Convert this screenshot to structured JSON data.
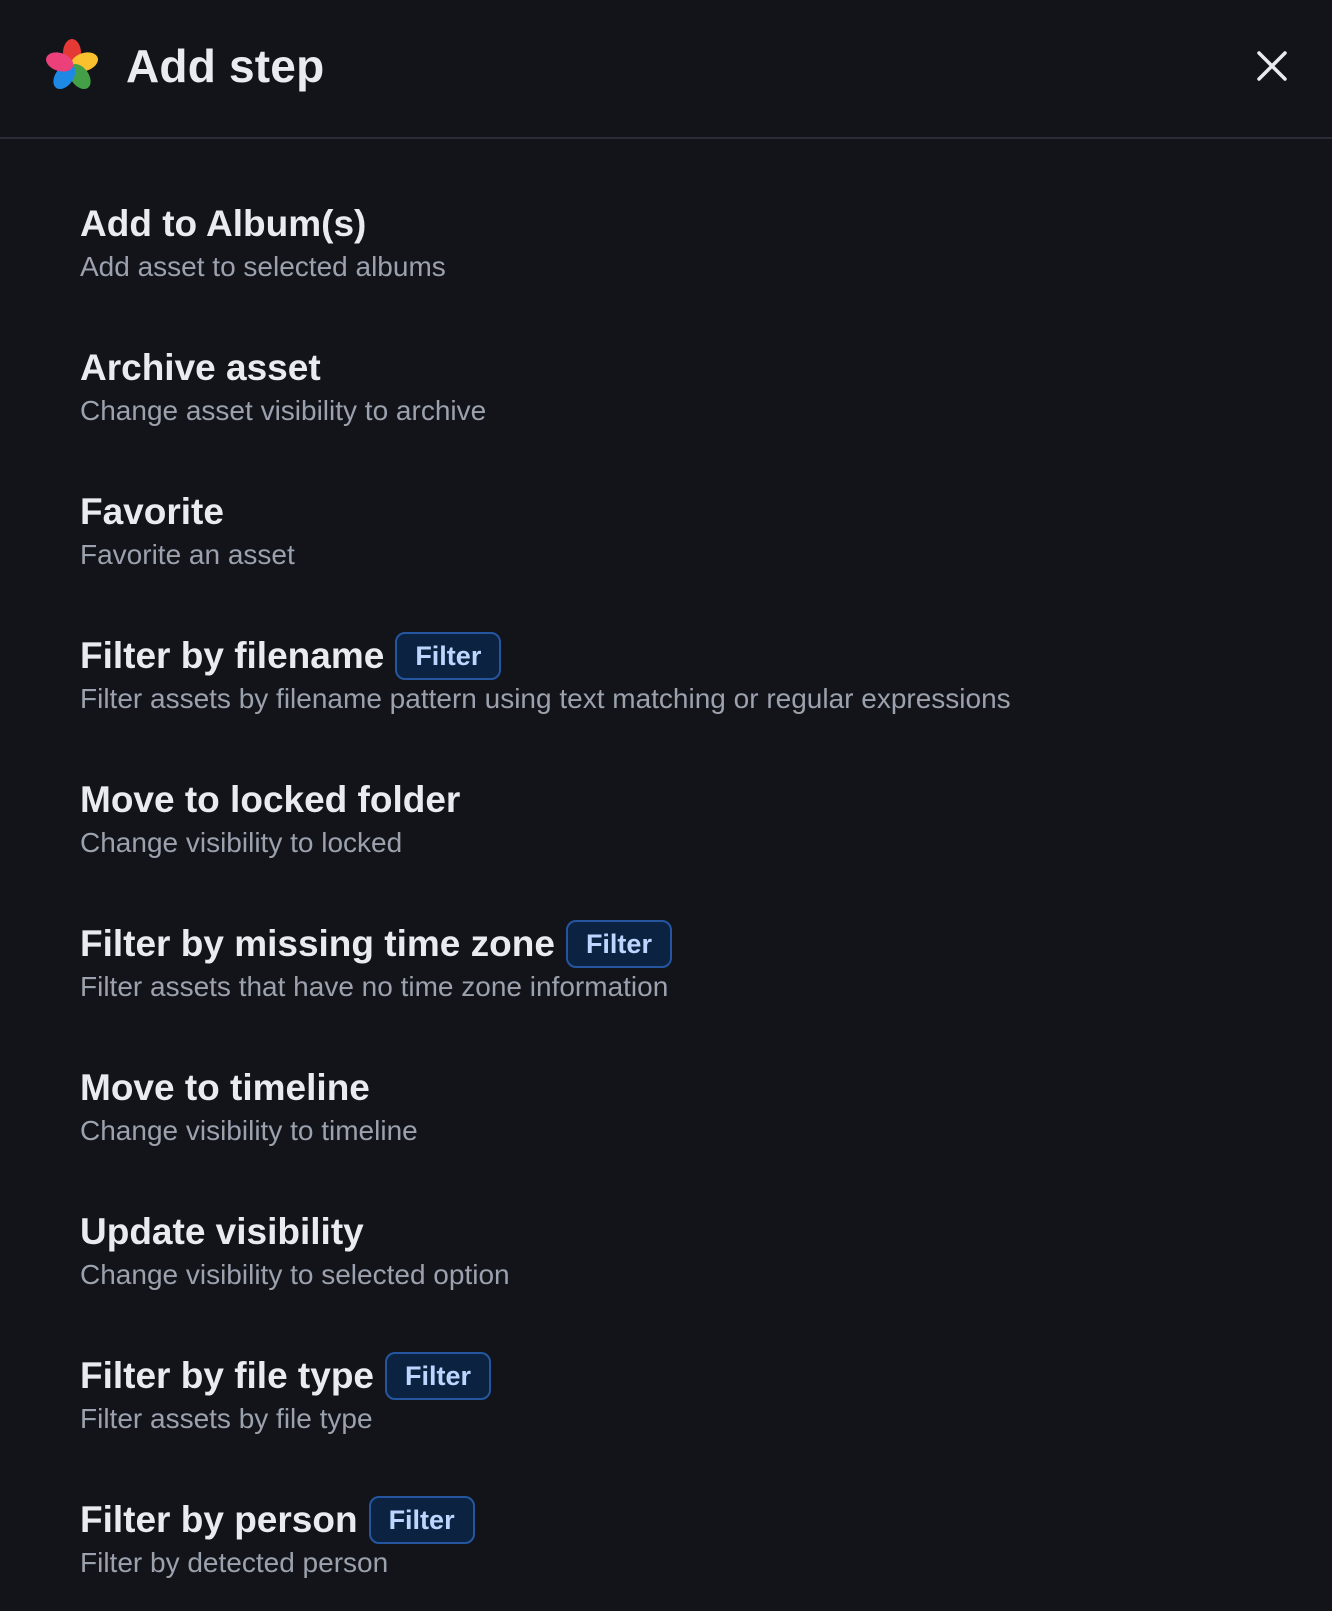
{
  "dialog": {
    "title": "Add step",
    "logo_icon": "app-pinwheel-logo",
    "close_icon": "close-icon"
  },
  "steps": [
    {
      "title": "Add to Album(s)",
      "description": "Add asset to selected albums",
      "badge": ""
    },
    {
      "title": "Archive asset",
      "description": "Change asset visibility to archive",
      "badge": ""
    },
    {
      "title": "Favorite",
      "description": "Favorite an asset",
      "badge": ""
    },
    {
      "title": "Filter by filename",
      "description": "Filter assets by filename pattern using text matching or regular expressions",
      "badge": "Filter"
    },
    {
      "title": "Move to locked folder",
      "description": "Change visibility to locked",
      "badge": ""
    },
    {
      "title": "Filter by missing time zone",
      "description": "Filter assets that have no time zone information",
      "badge": "Filter"
    },
    {
      "title": "Move to timeline",
      "description": "Change visibility to timeline",
      "badge": ""
    },
    {
      "title": "Update visibility",
      "description": "Change visibility to selected option",
      "badge": ""
    },
    {
      "title": "Filter by file type",
      "description": "Filter assets by file type",
      "badge": "Filter"
    },
    {
      "title": "Filter by person",
      "description": "Filter by detected person",
      "badge": "Filter"
    }
  ],
  "colors": {
    "background": "#12141a",
    "divider": "#2a2d35",
    "title_text": "#e9ebf0",
    "description_text": "#9ba1ad",
    "badge_border": "#2456a0",
    "badge_bg": "#0b2341",
    "badge_text": "#bcd6ff"
  }
}
